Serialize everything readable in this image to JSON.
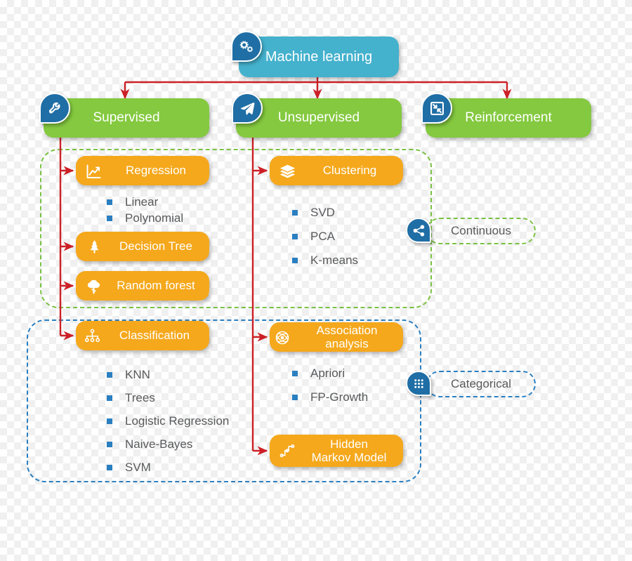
{
  "diagram": {
    "title": "Machine learning",
    "root": {
      "label": "Machine learning",
      "icon": "gears-icon",
      "color": "#44b1cd"
    },
    "branches": [
      {
        "label": "Supervised",
        "icon": "wrench-icon",
        "color": "#84c93f"
      },
      {
        "label": "Unsupervised",
        "icon": "paper-plane-icon",
        "color": "#84c93f"
      },
      {
        "label": "Reinforcement",
        "icon": "compress-arrows-icon",
        "color": "#84c93f"
      }
    ],
    "methods": [
      {
        "label": "Regression",
        "icon": "line-chart-icon",
        "color": "#f5a81c",
        "items": [
          "Linear",
          "Polynomial"
        ]
      },
      {
        "label": "Decision Tree",
        "icon": "pine-tree-icon",
        "color": "#f5a81c",
        "items": []
      },
      {
        "label": "Random forest",
        "icon": "tree-icon",
        "color": "#f5a81c",
        "items": []
      },
      {
        "label": "Clustering",
        "icon": "layers-icon",
        "color": "#f5a81c",
        "items": [
          "SVD",
          "PCA",
          "K-means"
        ]
      },
      {
        "label": "Classification",
        "icon": "hierarchy-icon",
        "color": "#f5a81c",
        "items": [
          "KNN",
          "Trees",
          "Logistic Regression",
          "Naive-Bayes",
          "SVM"
        ]
      },
      {
        "label": "Association analysis",
        "icon": "network-globe-icon",
        "color": "#f5a81c",
        "items": [
          "Apriori",
          "FP-Growth"
        ]
      },
      {
        "label_line1": "Hidden",
        "label_line2": "Markov Model",
        "icon": "node-path-icon",
        "color": "#f5a81c",
        "items": []
      }
    ],
    "tags": [
      {
        "label": "Continuous",
        "icon": "share-nodes-icon",
        "color": "#7ac143"
      },
      {
        "label": "Categorical",
        "icon": "dot-grid-icon",
        "color": "#2a7fc1"
      }
    ],
    "colors": {
      "root": "#44b1cd",
      "branch": "#84c93f",
      "method": "#f5a81c",
      "connector": "#cc2026",
      "badge": "#1f6ea5",
      "bullet": "#2a7fc1",
      "text_body": "#58595b",
      "group_continuous": "#7ac143",
      "group_categorical": "#2a7fc1"
    }
  }
}
